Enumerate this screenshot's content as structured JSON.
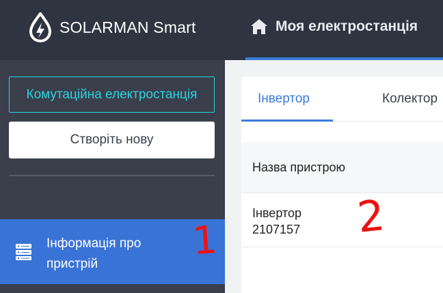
{
  "header": {
    "app_name": "SOLARMAN Smart",
    "nav_tab": "Моя електростанція"
  },
  "sidebar": {
    "station_button": "Комутаційна електростанція",
    "create_button": "Створіть нову",
    "menu": [
      {
        "label": "Інформація про пристрій",
        "icon": "server-icon",
        "active": true
      }
    ]
  },
  "main": {
    "tabs": [
      {
        "label": "Інвертор",
        "active": true
      },
      {
        "label": "Колектор",
        "active": false
      }
    ],
    "table": {
      "columns": [
        "Назва пристрою"
      ],
      "rows": [
        {
          "name_line1": "Інвертор",
          "name_line2": "2107157"
        }
      ]
    }
  },
  "annotations": [
    "1",
    "2"
  ],
  "colors": {
    "topbar": "#2e3440",
    "sidebar": "#3a3f4b",
    "accent": "#3a7bdb",
    "cyan": "#2ad4e0",
    "annotation": "#ee1111"
  }
}
